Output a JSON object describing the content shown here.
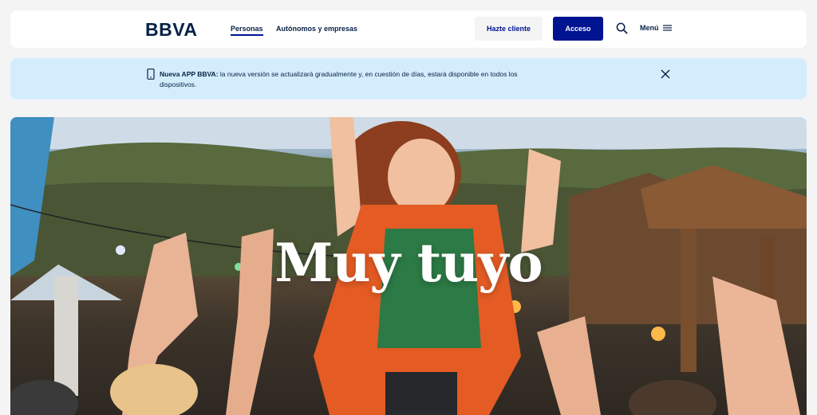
{
  "header": {
    "logo": "BBVA",
    "nav": [
      {
        "label": "Personas",
        "active": true
      },
      {
        "label": "Autónomos y empresas",
        "active": false
      }
    ],
    "cta_secondary": "Hazte cliente",
    "cta_primary": "Acceso",
    "search_icon": "search-icon",
    "menu_label": "Menú",
    "menu_icon": "hamburger-icon"
  },
  "banner": {
    "icon": "phone-icon",
    "title": "Nueva APP BBVA:",
    "text": " la nueva versión se actualizará gradualmente y, en cuestión de días, estará disponible en todos los dispositivos.",
    "close_icon": "close-icon"
  },
  "hero": {
    "title": "Muy tuyo",
    "image": "photo of people dancing and celebrating at an outdoor festival"
  },
  "colors": {
    "brand_navy": "#072146",
    "primary_button": "#001391",
    "banner_bg": "#d4edfc",
    "page_bg": "#f4f4f4"
  }
}
